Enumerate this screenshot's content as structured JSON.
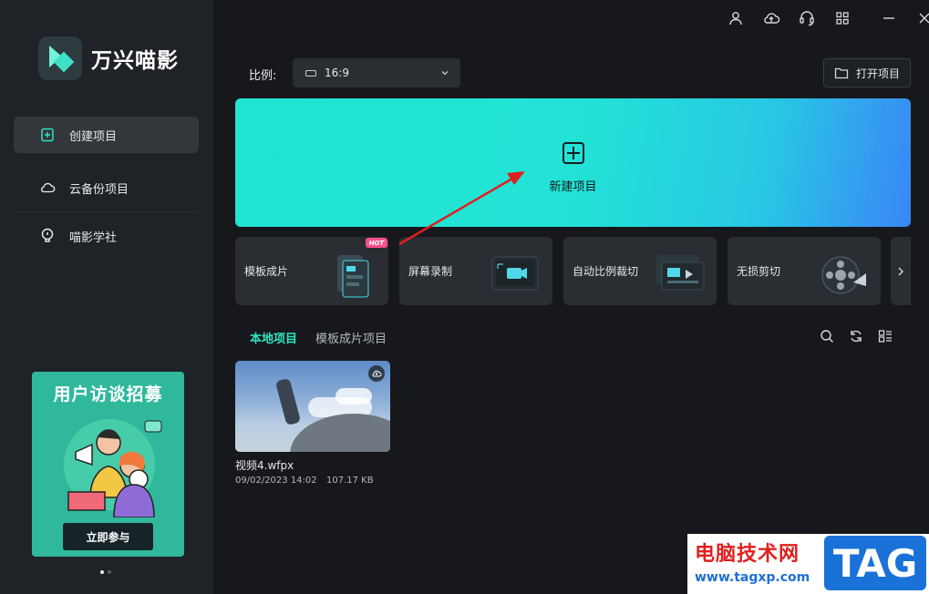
{
  "app": {
    "name": "万兴喵影"
  },
  "sidebar": {
    "items": [
      {
        "label": "创建项目",
        "icon": "plus-square-icon",
        "active": true
      },
      {
        "label": "云备份项目",
        "icon": "cloud-icon",
        "active": false
      },
      {
        "label": "喵影学社",
        "icon": "lightbulb-icon",
        "active": false
      }
    ],
    "promo": {
      "title": "用户访谈招募",
      "button": "立即参与"
    }
  },
  "topbar": {
    "icons": [
      "user-icon",
      "cloud-upload-icon",
      "headset-icon",
      "apps-grid-icon",
      "minimize-icon",
      "close-icon"
    ]
  },
  "ratio": {
    "label": "比例:",
    "value": "16:9"
  },
  "open_project": {
    "label": "打开项目"
  },
  "hero": {
    "label": "新建项目"
  },
  "features": [
    {
      "label": "模板成片",
      "badge": "HOT"
    },
    {
      "label": "屏幕录制"
    },
    {
      "label": "自动比例裁切"
    },
    {
      "label": "无损剪切"
    }
  ],
  "tabs": [
    {
      "label": "本地项目",
      "active": true
    },
    {
      "label": "模板成片项目",
      "active": false
    }
  ],
  "tools": [
    "search-icon",
    "refresh-icon",
    "list-view-icon"
  ],
  "projects": [
    {
      "name": "视频4.wfpx",
      "date": "09/02/2023 14:02",
      "size": "107.17 KB"
    }
  ],
  "watermark": {
    "title": "电脑技术网",
    "url": "www.tagxp.com",
    "tag": "TAG"
  },
  "colors": {
    "accent": "#2fe0c2",
    "hero_start": "#20e5d3",
    "hero_end": "#3a86f7",
    "arrow": "#e02020"
  }
}
